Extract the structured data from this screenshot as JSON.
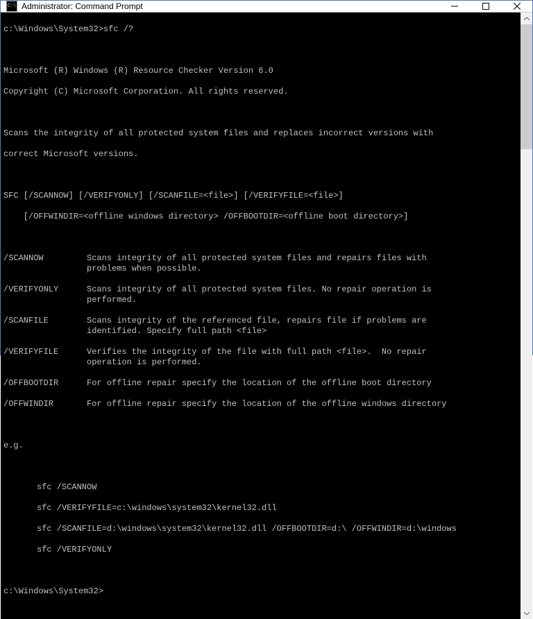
{
  "titlebar": {
    "icon_label": "C:\\",
    "title": "Administrator: Command Prompt"
  },
  "terminal": {
    "prompt1": "c:\\Windows\\System32>sfc /?",
    "header1": "Microsoft (R) Windows (R) Resource Checker Version 6.0",
    "header2": "Copyright (C) Microsoft Corporation. All rights reserved.",
    "desc1": "Scans the integrity of all protected system files and replaces incorrect versions with",
    "desc2": "correct Microsoft versions.",
    "usage1": "SFC [/SCANNOW] [/VERIFYONLY] [/SCANFILE=<file>] [/VERIFYFILE=<file>]",
    "usage2": "    [/OFFWINDIR=<offline windows directory> /OFFBOOTDIR=<offline boot directory>]",
    "options": [
      {
        "name": "/SCANNOW",
        "desc": "Scans integrity of all protected system files and repairs files with\nproblems when possible."
      },
      {
        "name": "/VERIFYONLY",
        "desc": "Scans integrity of all protected system files. No repair operation is\nperformed."
      },
      {
        "name": "/SCANFILE",
        "desc": "Scans integrity of the referenced file, repairs file if problems are\nidentified. Specify full path <file>"
      },
      {
        "name": "/VERIFYFILE",
        "desc": "Verifies the integrity of the file with full path <file>.  No repair\noperation is performed."
      },
      {
        "name": "/OFFBOOTDIR",
        "desc": "For offline repair specify the location of the offline boot directory"
      },
      {
        "name": "/OFFWINDIR",
        "desc": "For offline repair specify the location of the offline windows directory"
      }
    ],
    "eg_label": "e.g.",
    "examples": [
      "sfc /SCANNOW",
      "sfc /VERIFYFILE=c:\\windows\\system32\\kernel32.dll",
      "sfc /SCANFILE=d:\\windows\\system32\\kernel32.dll /OFFBOOTDIR=d:\\ /OFFWINDIR=d:\\windows",
      "sfc /VERIFYONLY"
    ],
    "prompt2": "c:\\Windows\\System32>"
  }
}
